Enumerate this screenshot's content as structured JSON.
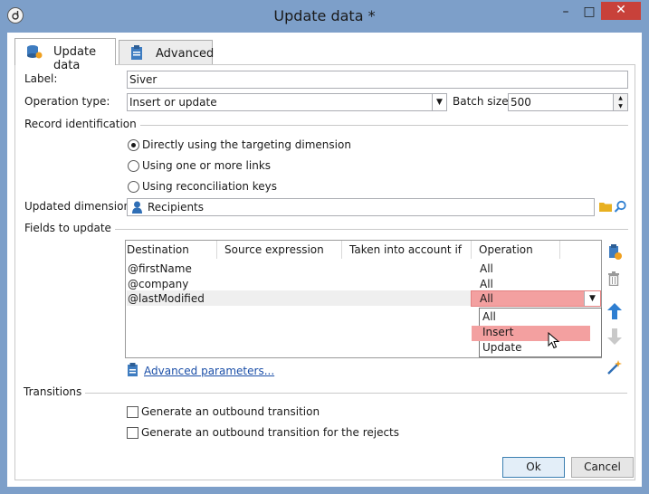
{
  "window": {
    "title": "Update data *",
    "minimize_glyph": "–",
    "maximize_glyph": "□",
    "close_glyph": "✕"
  },
  "tabs": [
    {
      "label": "Update data",
      "icon": "database-icon",
      "active": true
    },
    {
      "label": "Advanced",
      "icon": "clipboard-icon",
      "active": false
    }
  ],
  "form": {
    "label_caption": "Label:",
    "label_value": "Siver",
    "operation_type_caption": "Operation type:",
    "operation_type_value": "Insert or update",
    "batch_size_caption": "Batch size:",
    "batch_size_value": "500"
  },
  "record_identification": {
    "heading": "Record identification",
    "options": [
      {
        "label": "Directly using the targeting dimension",
        "selected": true
      },
      {
        "label": "Using one or more links",
        "selected": false
      },
      {
        "label": "Using reconciliation keys",
        "selected": false
      }
    ],
    "updated_dimension_caption": "Updated dimension:",
    "updated_dimension_value": "Recipients"
  },
  "fields_to_update": {
    "heading": "Fields to update",
    "columns": [
      "Destination",
      "Source expression",
      "Taken into account if",
      "Operation"
    ],
    "rows": [
      {
        "destination": "@firstName",
        "source": "",
        "condition": "",
        "operation": "All"
      },
      {
        "destination": "@company",
        "source": "",
        "condition": "",
        "operation": "All"
      },
      {
        "destination": "@lastModified",
        "source": "",
        "condition": "",
        "operation": "All"
      }
    ],
    "dropdown_options": [
      "All",
      "Insert",
      "Update"
    ],
    "highlighted_option": "Insert",
    "advanced_link": "Advanced parameters..."
  },
  "transitions": {
    "heading": "Transitions",
    "checkboxes": [
      {
        "label": "Generate an outbound transition",
        "checked": false
      },
      {
        "label": "Generate an outbound transition for the rejects",
        "checked": false
      }
    ]
  },
  "buttons": {
    "ok": "Ok",
    "cancel": "Cancel"
  },
  "colors": {
    "titlebar": "#7d9fc9",
    "close": "#c8413a",
    "highlight": "#f3a0a0",
    "link": "#1b4fa8",
    "arrow_blue": "#2f7fd1"
  }
}
